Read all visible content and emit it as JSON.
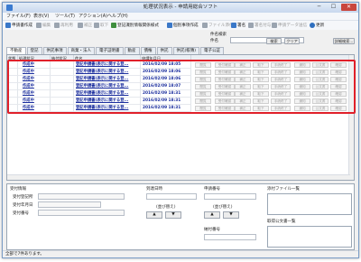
{
  "window": {
    "title": "処理状況表示 - 申請用総合ソフト",
    "min": "─",
    "max": "☐",
    "close": "✕"
  },
  "menu": [
    "ファイル(F)",
    "表示(V)",
    "ツール(T)",
    "アクション(A)",
    "ヘルプ(H)"
  ],
  "toolbar": {
    "items": [
      {
        "label": "申請書作成",
        "icon_color": "#3a78c8",
        "enabled": true
      },
      {
        "label": "編集",
        "icon_color": "#9aa4b0",
        "enabled": false
      },
      {
        "label": "再利用",
        "icon_color": "#9aa4b0",
        "enabled": false
      },
      {
        "label": "補正",
        "icon_color": "#9aa4b0",
        "enabled": false
      },
      {
        "label": "取下",
        "icon_color": "#9aa4b0",
        "enabled": false
      },
      {
        "label": "登記識別情報関係様式",
        "icon_color": "#3f8f3f",
        "enabled": true
      },
      {
        "label": "個別事項作成",
        "icon_color": "#3a78c8",
        "enabled": true
      },
      {
        "label": "ファイル添付",
        "icon_color": "#9aa4b0",
        "enabled": false
      },
      {
        "label": "署名",
        "icon_color": "#3a78c8",
        "enabled": true
      },
      {
        "label": "署名付与",
        "icon_color": "#9aa4b0",
        "enabled": false
      },
      {
        "label": "申請データ送信",
        "icon_color": "#9aa4b0",
        "enabled": false
      },
      {
        "label": "更新",
        "icon_color": "#2f6fbf",
        "enabled": true
      }
    ]
  },
  "search": {
    "heading": "件名検索",
    "field_label": "件名",
    "value": "",
    "search_button": "検索",
    "clear_button": "クリア",
    "detail_button": "詳細検索..."
  },
  "tabs": [
    "不動産",
    "登記",
    "供託事項",
    "商業・法人",
    "電子証明書",
    "動産",
    "債権",
    "供託",
    "供託(帳簿)",
    "電子公証"
  ],
  "grid": {
    "columns": [
      "状態",
      "処理状況",
      "納付状況",
      "件名",
      "申請年月日",
      "",
      "",
      "",
      "",
      "",
      "",
      "",
      "",
      ""
    ],
    "rows": [
      {
        "status": "作成中",
        "subject": "登記申請書(表示に関する登...",
        "date": "2016/02/09 18:05",
        "buttons": [
          "閲覧",
          "受付確認",
          "補正",
          "取下",
          "手続終了",
          "通知",
          "公文書",
          "確認"
        ]
      },
      {
        "status": "作成中",
        "subject": "登記申請書(表示に関する登...",
        "date": "2016/02/09 18:06",
        "buttons": [
          "閲覧",
          "受付確認",
          "補正",
          "取下",
          "手続終了",
          "通知",
          "公文書",
          "確認"
        ]
      },
      {
        "status": "作成中",
        "subject": "登記申請書(表示に関する登...",
        "date": "2016/02/09 18:06",
        "buttons": [
          "閲覧",
          "受付確認",
          "補正",
          "取下",
          "手続終了",
          "通知",
          "公文書",
          "確認"
        ]
      },
      {
        "status": "作成中",
        "subject": "登記申請書(表示に関する登...",
        "date": "2016/02/09 18:07",
        "buttons": [
          "閲覧",
          "受付確認",
          "補正",
          "取下",
          "手続終了",
          "通知",
          "公文書",
          "確認"
        ]
      },
      {
        "status": "作成中",
        "subject": "登記申請書(表示に関する登...",
        "date": "2016/02/09 18:31",
        "buttons": [
          "閲覧",
          "受付確認",
          "補正",
          "取下",
          "手続終了",
          "通知",
          "公文書",
          "確認"
        ]
      },
      {
        "status": "作成中",
        "subject": "登記申請書(表示に関する登...",
        "date": "2016/02/09 18:31",
        "buttons": [
          "閲覧",
          "受付確認",
          "補正",
          "取下",
          "手続終了",
          "通知",
          "公文書",
          "確認"
        ]
      },
      {
        "status": "作成中",
        "subject": "登記申請書(表示に関する登...",
        "date": "2016/02/09 18:31",
        "buttons": [
          "閲覧",
          "受付確認",
          "補正",
          "取下",
          "手続終了",
          "通知",
          "公文書",
          "確認"
        ]
      }
    ]
  },
  "detail": {
    "section_label": "受付情報",
    "receipt_office": "受付登記所",
    "receipt_date": "受付年月日",
    "receipt_no": "受付番号",
    "application_no_label": "到達日時",
    "applicant_no_label": "申請番号",
    "prev_btn": "▲",
    "next_btn": "▼",
    "spin_label1": "(並び替え)",
    "spin_label2": "(並び替え)",
    "payment_no_label": "納付番号",
    "attach_list": "添付ファイル一覧",
    "official_doc_list": "取得公文書一覧"
  },
  "status": "全部で7件あります。"
}
